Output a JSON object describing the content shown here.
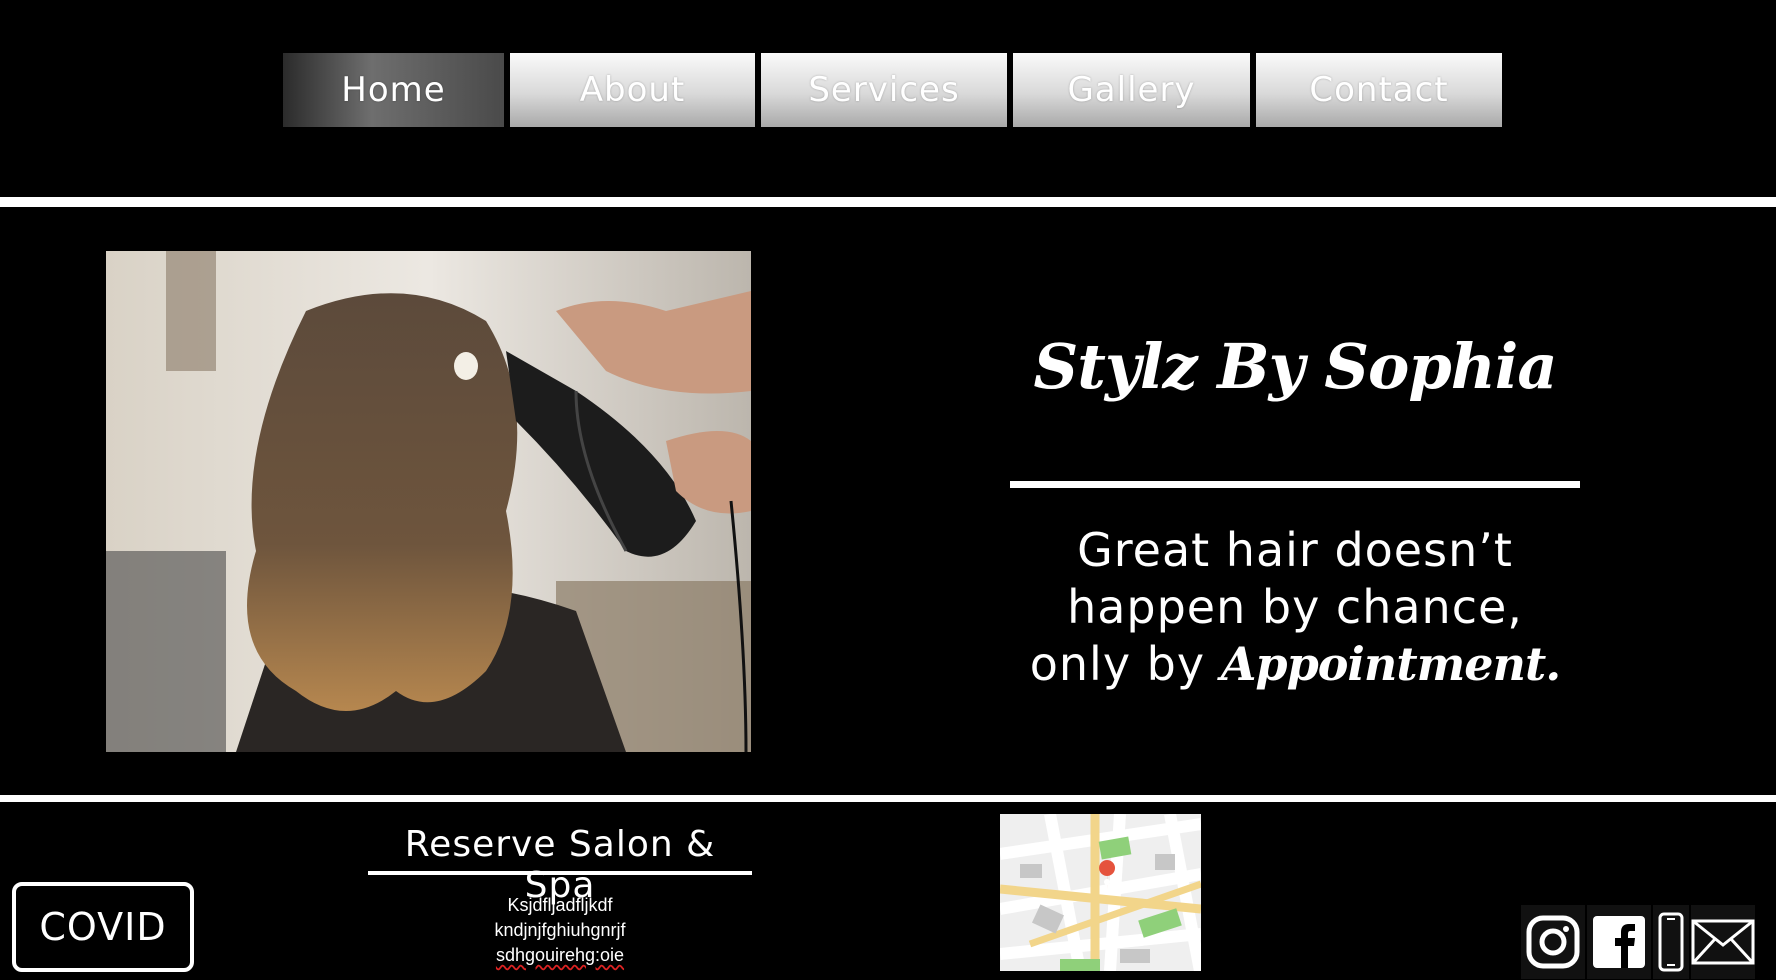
{
  "nav": {
    "items": [
      {
        "label": "Home",
        "active": true
      },
      {
        "label": "About"
      },
      {
        "label": "Services"
      },
      {
        "label": "Gallery"
      },
      {
        "label": "Contact"
      }
    ]
  },
  "hero": {
    "photo_alt": "",
    "title": "Stylz By Sophia",
    "tagline_line1": "Great hair doesn’t",
    "tagline_line2": "happen by chance,",
    "tagline_line3_prefix": "only by ",
    "tagline_line3_emphasis": "Appointment."
  },
  "footer": {
    "covid_label": "COVID",
    "salon_name": "Reserve Salon & Spa",
    "filler_lines": [
      "Ksjdfljadfljkdf",
      "kndjnjfghiuhgnrjf",
      "sdhgouirehg:oie"
    ],
    "map_icon": "map-thumbnail",
    "socials": [
      "instagram-icon",
      "facebook-icon",
      "phone-icon",
      "mail-icon"
    ]
  },
  "colors": {
    "background": "#000000",
    "text": "#ffffff",
    "pin": "#e5533d"
  }
}
